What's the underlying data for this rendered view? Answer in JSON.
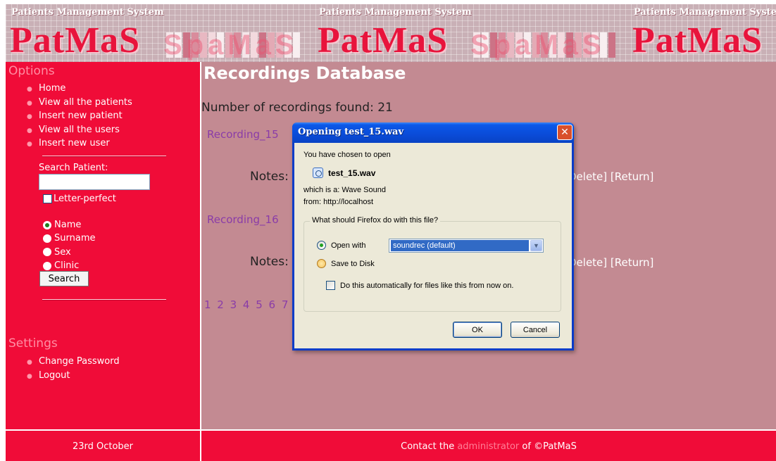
{
  "banner": {
    "caption": "Patients Management System",
    "logo": "PatMaS",
    "ghost_text": "SpaMaS",
    "mosaic_colors": [
      "#f5e6e9",
      "#e3aab5",
      "#f3d9de",
      "#d98c9c",
      "#f8eef0",
      "#e8b8c2",
      "#cc7386"
    ]
  },
  "sidebar": {
    "options_heading": "Options",
    "nav": [
      {
        "label": "Home"
      },
      {
        "label": "View all the patients"
      },
      {
        "label": "Insert new patient"
      },
      {
        "label": "View all the users"
      },
      {
        "label": "Insert new user"
      }
    ],
    "search_label": "Search Patient:",
    "search_value": "",
    "letter_perfect": "Letter-perfect",
    "radios": [
      {
        "label": "Name",
        "checked": true
      },
      {
        "label": "Surname",
        "checked": false
      },
      {
        "label": "Sex",
        "checked": false
      },
      {
        "label": "Clinic",
        "checked": false
      }
    ],
    "search_button": "Search",
    "settings_heading": "Settings",
    "settings": [
      {
        "label": "Change Password"
      },
      {
        "label": "Logout"
      }
    ]
  },
  "main": {
    "title": "Recordings Database",
    "count_text": "Number of recordings found: 21",
    "recordings": [
      {
        "link": "Recording_15",
        "notes": "Notes:",
        "actions": "Delete] [Return]"
      },
      {
        "link": "Recording_16",
        "notes": "Notes:",
        "actions": "Delete] [Return]"
      }
    ],
    "pages": "1 2 3 4 5 6 7"
  },
  "footer": {
    "date": "23rd October",
    "contact_prefix": "Contact the",
    "contact_link": "administrator",
    "contact_suffix": "of ©PatMaS"
  },
  "dialog": {
    "title": "Opening test_15.wav",
    "close_symbol": "✕",
    "intro": "You have chosen to open",
    "file_name": "test_15.wav",
    "file_icon": "wave-sound-file-icon",
    "which_is": "which is a:  Wave Sound",
    "from": "from:  http://localhost",
    "group_label": "What should Firefox do with this file?",
    "open_with_label": "Open with",
    "open_with_value": "soundrec (default)",
    "save_label": "Save to Disk",
    "auto_label": "Do this automatically for files like this from now on.",
    "ok_label": "OK",
    "cancel_label": "Cancel",
    "selected_option": "open_with"
  },
  "colors": {
    "sidebar": "#f00c38",
    "main": "#c38a92",
    "link": "#8a3ca8",
    "titlebar": "#0a4bd8"
  }
}
